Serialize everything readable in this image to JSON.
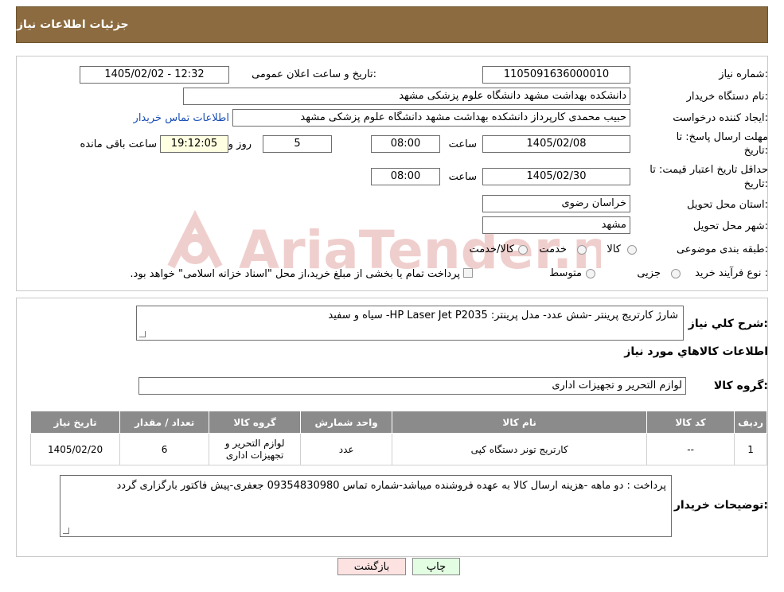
{
  "header": {
    "title": "جزئیات اطلاعات نیاز"
  },
  "form": {
    "need_number_label": "شماره نیاز:",
    "need_number": "1105091636000010",
    "announce_label": "تاریخ و ساعت اعلان عمومی:",
    "announce_value": "1405/02/02 - 12:32",
    "buyer_org_label": "نام دستگاه خریدار:",
    "buyer_org": "دانشکده بهداشت مشهد   دانشگاه علوم پزشکی مشهد",
    "creator_label": "ایجاد کننده درخواست:",
    "creator": "حبیب محمدی کارپرداز دانشکده بهداشت مشهد   دانشگاه علوم پزشکی مشهد",
    "contact_link": "اطلاعات تماس خریدار",
    "deadline_label_1": "مهلت ارسال پاسخ: تا",
    "deadline_label_2": "تاریخ:",
    "deadline_date": "1405/02/08",
    "time_label": "ساعت",
    "deadline_time": "08:00",
    "days_value": "5",
    "days_label": "روز و",
    "remaining_time": "19:12:05",
    "remaining_label": "ساعت باقی مانده",
    "validity_label_1": "حداقل تاریخ اعتبار قیمت: تا",
    "validity_label_2": "تاریخ:",
    "validity_date": "1405/02/30",
    "validity_time": "08:00",
    "province_label": "استان محل تحویل:",
    "province": "خراسان رضوی",
    "city_label": "شهر محل تحویل:",
    "city": "مشهد",
    "category_label": "طبقه بندی موضوعی:",
    "category_options": [
      "کالا",
      "خدمت",
      "کالا/خدمت"
    ],
    "process_label": "نوع فرآیند خرید :",
    "process_options": [
      "جزیی",
      "متوسط"
    ],
    "process_note": "پرداخت تمام یا بخشی از مبلغ خرید،از محل \"اسناد خزانه اسلامی\" خواهد بود."
  },
  "description": {
    "label": "شرح کلي نياز:",
    "value": "شارژ کارتریج پرینتر -شش عدد- مدل پرینتر: HP Laser Jet  P2035-  سیاه و سفید"
  },
  "goods_info": {
    "title": "اطلاعات کالاهاي مورد نياز"
  },
  "goods_group": {
    "label": "گروه کالا:",
    "value": "لوازم التحریر و تجهیزات اداری"
  },
  "table": {
    "headers": [
      "رديف",
      "کد کالا",
      "نام کالا",
      "واحد شمارش",
      "گروه کالا",
      "تعداد / مقدار",
      "تاریخ نیاز"
    ],
    "rows": [
      [
        "1",
        "--",
        "کارتریج تونر دستگاه کپی",
        "عدد",
        "لوازم التحریر و تجهیزات اداری",
        "6",
        "1405/02/20"
      ]
    ]
  },
  "buyer_notes": {
    "label": "توضیحات خریدار:",
    "value": "پرداخت : دو ماهه  -هزینه ارسال کالا به عهده فروشنده میباشد-شماره تماس 09354830980 جعفری-پیش فاکتور بارگزاری گردد"
  },
  "buttons": {
    "print": "چاپ",
    "back": "بازگشت"
  },
  "watermark": {
    "text": "AriaTender.neT"
  },
  "colors": {
    "header_bg": "#8b6b3f",
    "table_header_bg": "#8b8b8b",
    "back_button_bg": "#fde2e2",
    "print_button_bg": "#e2fde2"
  }
}
